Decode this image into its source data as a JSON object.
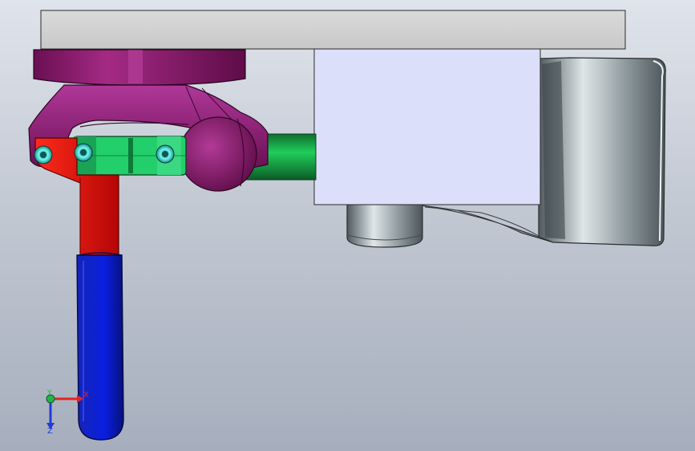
{
  "viewport": {
    "background_top": "#dfe4ec",
    "background_bottom": "#a6aebd"
  },
  "model": {
    "colors": {
      "top_plate": "#d1d1d1",
      "clamp_body": "#8a1a6a",
      "link_arm": "#e80a0a",
      "handle_grip": "#0a1ee0",
      "spindle_rod": "#13a84a",
      "pivot_pin": "#35e0d8",
      "mount_block": "#dcdffa",
      "bracket": "#b7c1c6"
    }
  },
  "triad": {
    "x_label": "X",
    "y_label": "Y",
    "z_label": "Z",
    "x_color": "#e32222",
    "y_color": "#22b34a",
    "z_color": "#1e3bd8"
  }
}
